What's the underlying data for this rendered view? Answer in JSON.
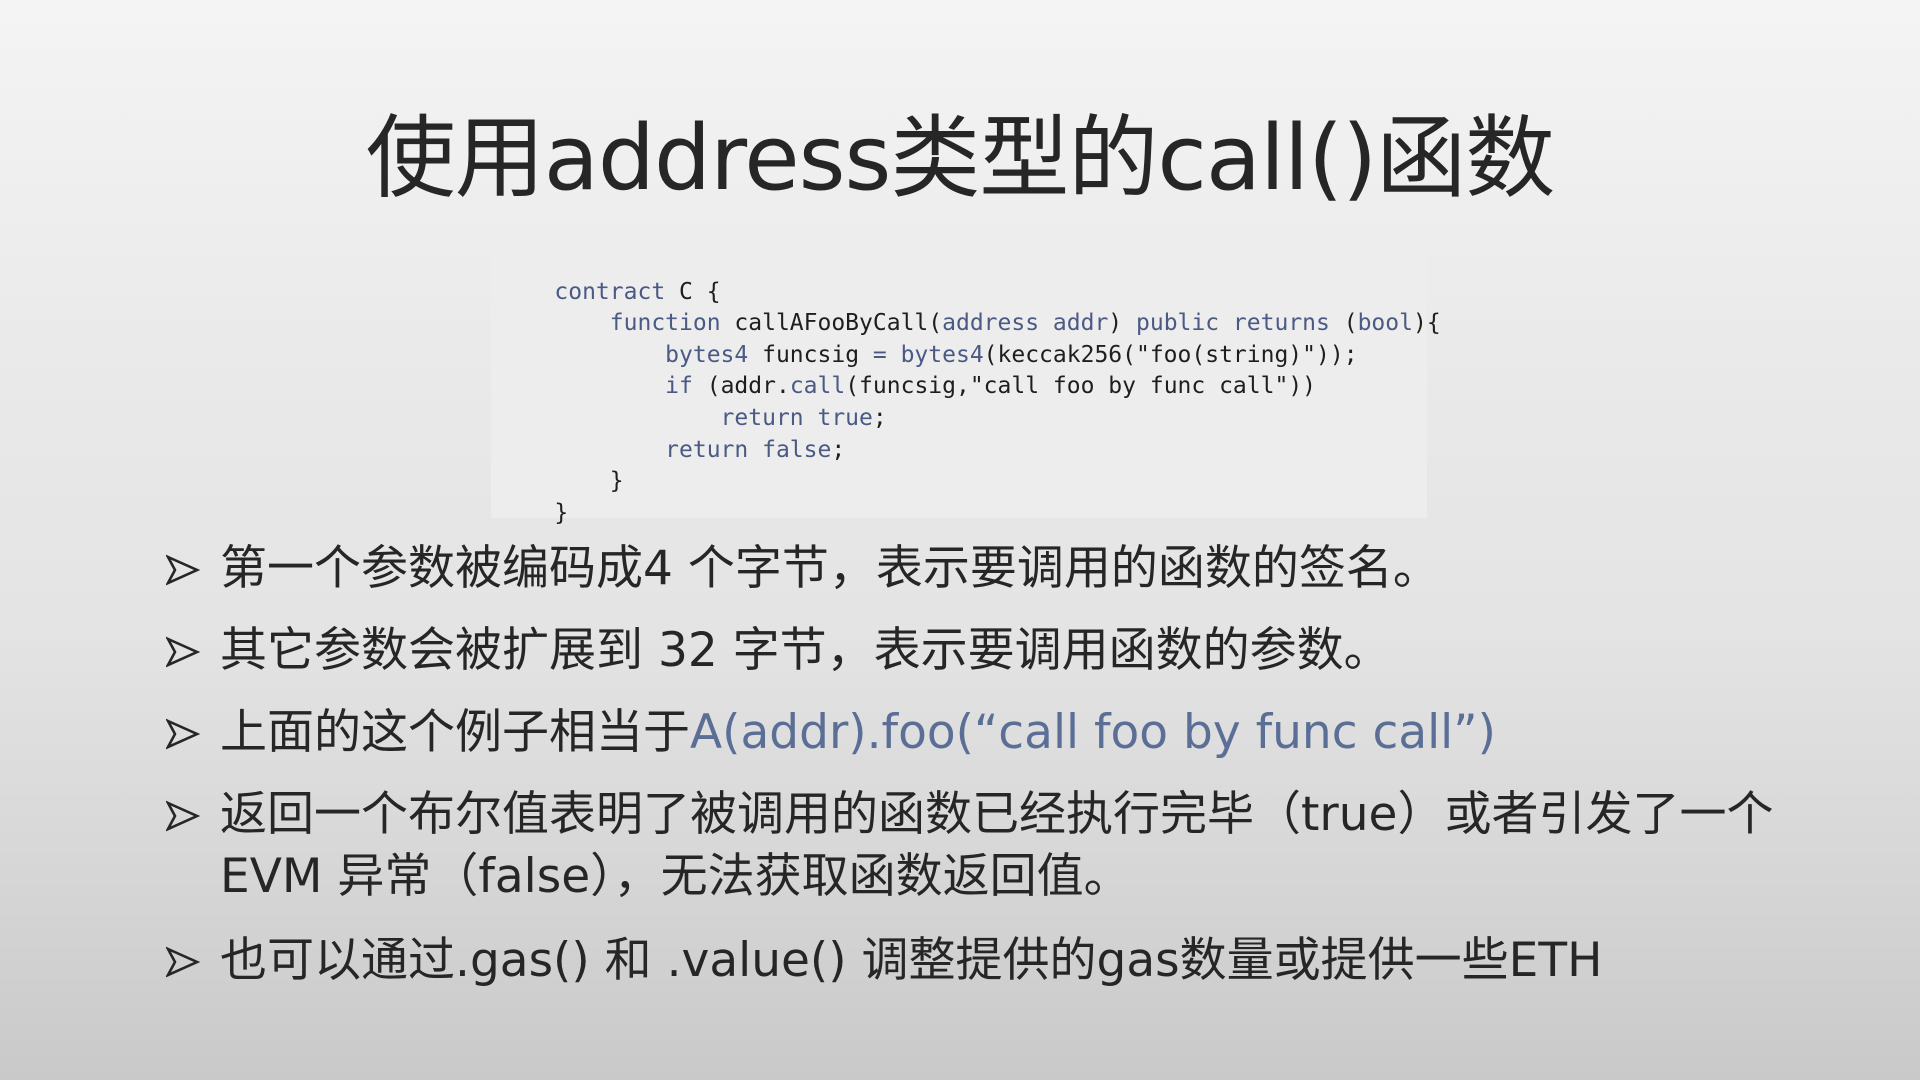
{
  "slide": {
    "title": "使用address类型的call()函数",
    "code": [
      [
        {
          "t": "contract ",
          "c": "kw"
        },
        {
          "t": "C {",
          "c": "pl"
        }
      ],
      [
        {
          "t": "    function ",
          "c": "kw"
        },
        {
          "t": "callAFooByCall(",
          "c": "pl"
        },
        {
          "t": "address addr",
          "c": "kw"
        },
        {
          "t": ") ",
          "c": "pl"
        },
        {
          "t": "public returns ",
          "c": "kw"
        },
        {
          "t": "(",
          "c": "pl"
        },
        {
          "t": "bool",
          "c": "kw"
        },
        {
          "t": "){",
          "c": "pl"
        }
      ],
      [
        {
          "t": "        bytes4 ",
          "c": "kw"
        },
        {
          "t": "funcsig ",
          "c": "pl"
        },
        {
          "t": "= bytes4",
          "c": "kw"
        },
        {
          "t": "(keccak256(\"foo(string)\"));",
          "c": "pl"
        }
      ],
      [
        {
          "t": "        if ",
          "c": "kw"
        },
        {
          "t": "(addr.",
          "c": "pl"
        },
        {
          "t": "call",
          "c": "kw"
        },
        {
          "t": "(funcsig,\"call foo by func call\"))",
          "c": "pl"
        }
      ],
      [
        {
          "t": "            return true",
          "c": "kw"
        },
        {
          "t": ";",
          "c": "pl"
        }
      ],
      [
        {
          "t": "        return false",
          "c": "kw"
        },
        {
          "t": ";",
          "c": "pl"
        }
      ],
      [
        {
          "t": "    }",
          "c": "pl"
        }
      ],
      [
        {
          "t": "}",
          "c": "pl"
        }
      ]
    ],
    "bullets": [
      {
        "text": "第一个参数被编码成4 个字节，表示要调用的函数的签名。"
      },
      {
        "text": "其它参数会被扩展到 32 字节，表示要调用函数的参数。"
      },
      {
        "text": "上面的这个例子相当于",
        "accent": "A(addr).foo(“call foo by func call”)"
      },
      {
        "text": "返回一个布尔值表明了被调用的函数已经执行完毕（true）或者引发了一个 EVM 异常（false），无法获取函数返回值。"
      },
      {
        "text": "也可以通过.gas() 和 .value() 调整提供的gas数量或提供一些ETH"
      }
    ]
  },
  "colors": {
    "title_text": "#262626",
    "code_keyword": "#4a5a84",
    "code_plain": "#1e1e1e",
    "code_background": "#ededed",
    "accent_text": "#5a6e96"
  },
  "icons": {
    "bullet_marker": "arrowhead-bullet-icon"
  }
}
